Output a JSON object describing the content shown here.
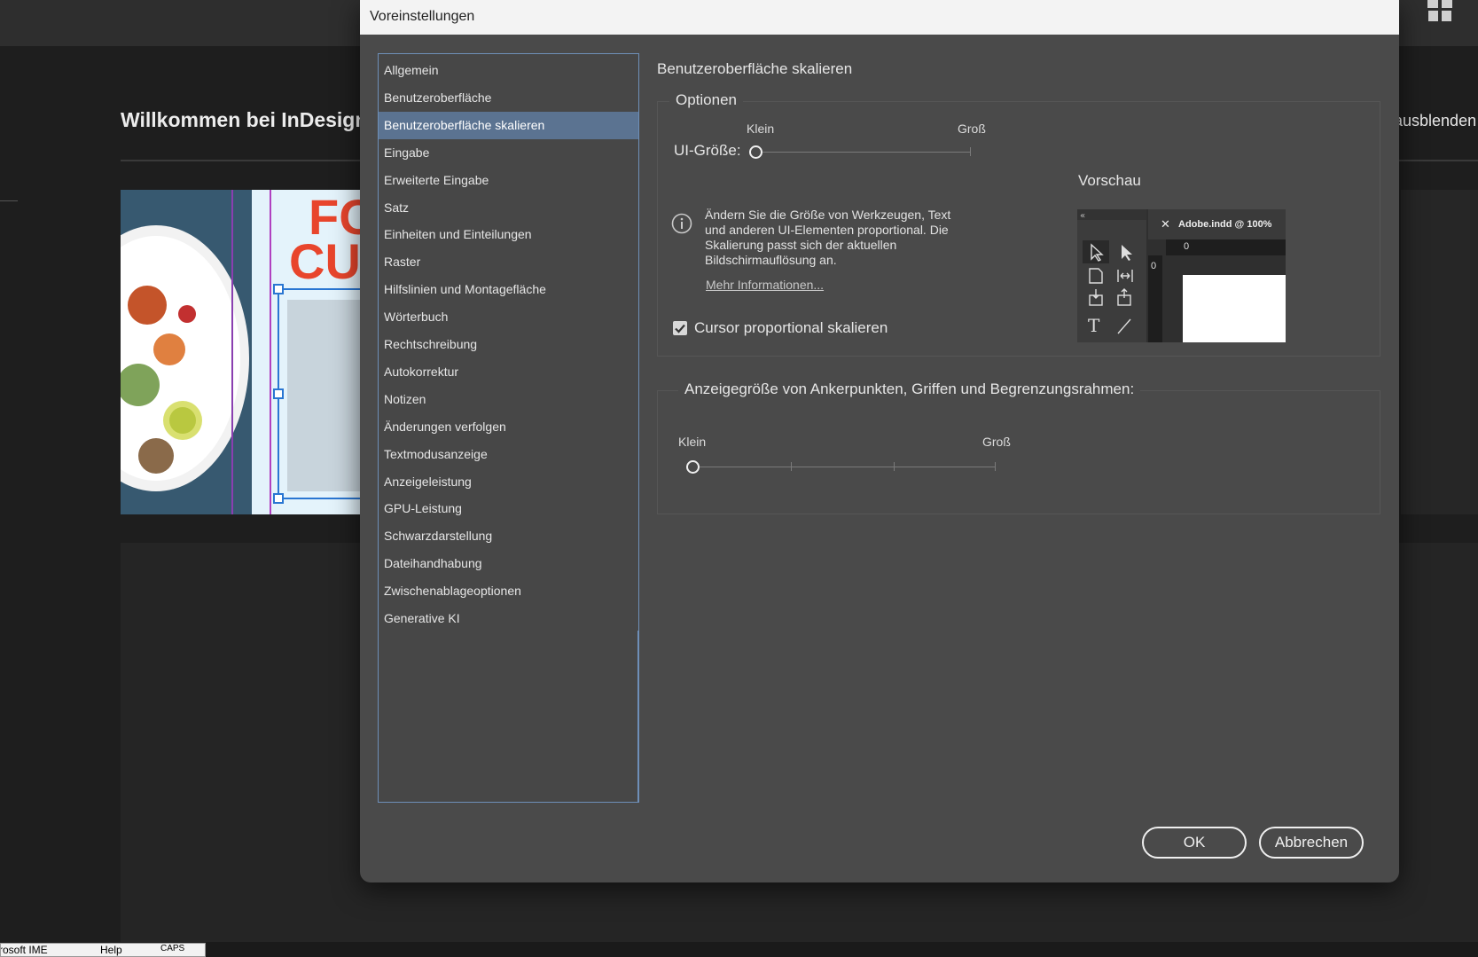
{
  "background": {
    "welcome_title": "Willkommen bei InDesign, …",
    "hide_link": "ausblenden",
    "hero_headline_partial": [
      "FO",
      "CU"
    ],
    "ime": {
      "ime_label": "rosoft IME",
      "help_label": "Help",
      "caps_label": "CAPS"
    }
  },
  "dialog": {
    "title": "Voreinstellungen",
    "categories": [
      "Allgemein",
      "Benutzeroberfläche",
      "Benutzeroberfläche skalieren",
      "Eingabe",
      "Erweiterte Eingabe",
      "Satz",
      "Einheiten und Einteilungen",
      "Raster",
      "Hilfslinien und Montagefläche",
      "Wörterbuch",
      "Rechtschreibung",
      "Autokorrektur",
      "Notizen",
      "Änderungen verfolgen",
      "Textmodusanzeige",
      "Anzeigeleistung",
      "GPU-Leistung",
      "Schwarzdarstellung",
      "Dateihandhabung",
      "Zwischenablageoptionen",
      "Generative KI"
    ],
    "selected_category_index": 2,
    "section_title": "Benutzeroberfläche skalieren",
    "options": {
      "legend": "Optionen",
      "ui_size_label": "UI-Größe:",
      "slider_min_label": "Klein",
      "slider_max_label": "Groß",
      "ui_size_value": 0,
      "info_text": "Ändern Sie die Größe von Werkzeugen, Text und anderen UI-Elementen proportional. Die Skalierung passt sich der aktuellen Bildschirmauflösung an.",
      "more_info_link": "Mehr Informationen...",
      "cursor_checkbox_label": "Cursor proportional skalieren",
      "cursor_checked": true,
      "preview_label": "Vorschau",
      "preview_tab_title": "Adobe.indd @ 100%",
      "preview_ruler_zero": "0"
    },
    "anchor": {
      "legend": "Anzeigegröße von Ankerpunkten, Griffen und Begrenzungsrahmen:",
      "slider_min_label": "Klein",
      "slider_max_label": "Groß",
      "value": 0
    },
    "buttons": {
      "ok": "OK",
      "cancel": "Abbrechen"
    }
  },
  "colors": {
    "dialog_bg": "#4a4a4a",
    "selection": "#5b7391",
    "list_border": "#6e8fb8",
    "app_bg": "#1e1e1e"
  },
  "icons": [
    "gift-icon",
    "info-icon",
    "checkmark-icon",
    "selection-tool-icon",
    "direct-selection-tool-icon",
    "page-tool-icon",
    "gap-tool-icon",
    "content-collector-icon",
    "content-placer-icon",
    "type-tool-icon",
    "line-tool-icon",
    "close-icon"
  ]
}
